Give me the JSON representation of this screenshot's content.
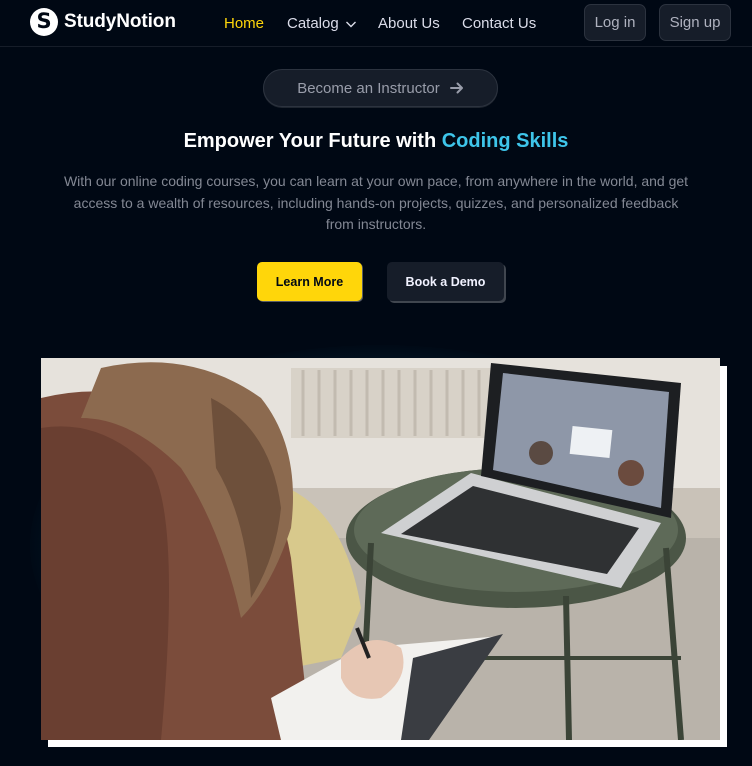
{
  "brand": {
    "name": "StudyNotion",
    "logo_letter": "S"
  },
  "nav": {
    "links": [
      {
        "label": "Home"
      },
      {
        "label": "Catalog"
      },
      {
        "label": "About Us"
      },
      {
        "label": "Contact Us"
      }
    ],
    "login_label": "Log in",
    "signup_label": "Sign up"
  },
  "hero": {
    "instructor_label": "Become an Instructor",
    "title_prefix": "Empower Your Future with ",
    "title_highlight": "Coding Skills",
    "description": "With our online coding courses, you can learn at your own pace, from anywhere in the world, and get access to a wealth of resources, including hands-on projects, quizzes, and personalized feedback from instructors.",
    "learn_more_label": "Learn More",
    "book_demo_label": "Book a Demo"
  },
  "colors": {
    "background": "#000814",
    "accent_yellow": "#ffd60a",
    "highlight_blue": "#3ec5ea",
    "glow": "#118ab2"
  },
  "icons": {
    "chevron": "chevron-down-icon",
    "arrow": "arrow-right-icon"
  }
}
